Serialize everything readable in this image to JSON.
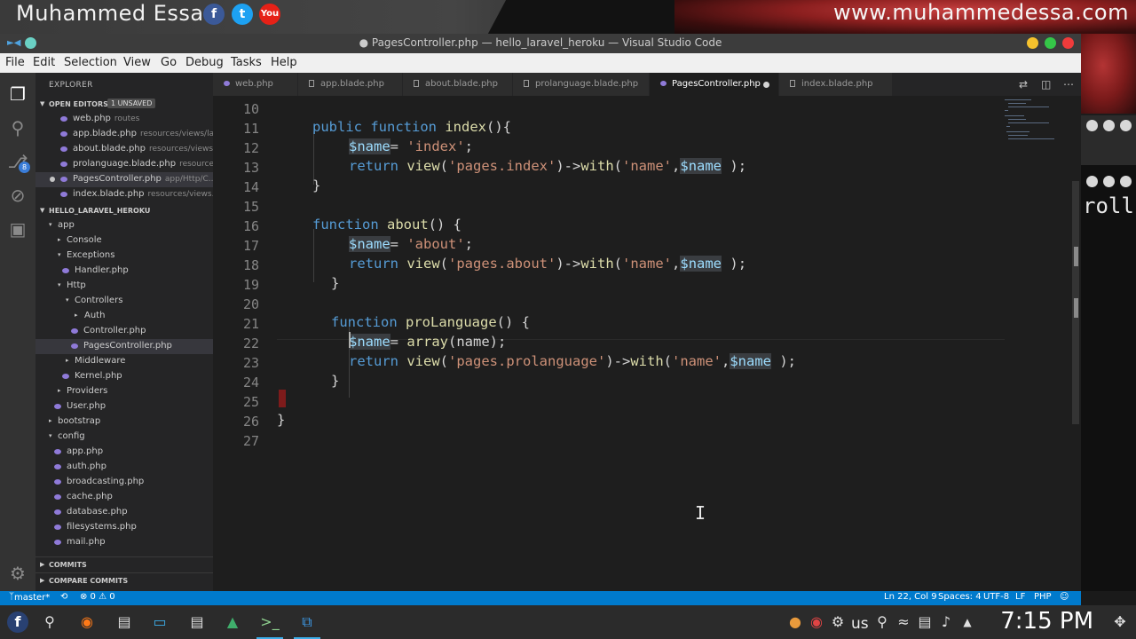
{
  "banner": {
    "name": "Muhammed Essa",
    "url": "www.muhammedessa.com",
    "social": {
      "facebook": "f",
      "twitter": "t",
      "youtube": "You"
    }
  },
  "side_terminal": {
    "text": "roll"
  },
  "window": {
    "title": "● PagesController.php — hello_laravel_heroku — Visual Studio Code"
  },
  "menu": [
    "File",
    "Edit",
    "Selection",
    "View",
    "Go",
    "Debug",
    "Tasks",
    "Help"
  ],
  "activity": {
    "scm_badge": "8"
  },
  "explorer": {
    "title": "EXPLORER",
    "open_editors_label": "OPEN EDITORS",
    "unsaved_badge": "1 UNSAVED",
    "open_editors": [
      {
        "name": "web.php",
        "path": "routes"
      },
      {
        "name": "app.blade.php",
        "path": "resources/views/la..."
      },
      {
        "name": "about.blade.php",
        "path": "resources/views..."
      },
      {
        "name": "prolanguage.blade.php",
        "path": "resource..."
      },
      {
        "name": "PagesController.php",
        "path": "app/Http/C..."
      },
      {
        "name": "index.blade.php",
        "path": "resources/views..."
      }
    ],
    "project_label": "HELLO_LARAVEL_HEROKU",
    "tree": [
      {
        "name": "app"
      },
      {
        "name": "Console"
      },
      {
        "name": "Exceptions"
      },
      {
        "name": "Handler.php"
      },
      {
        "name": "Http"
      },
      {
        "name": "Controllers"
      },
      {
        "name": "Auth"
      },
      {
        "name": "Controller.php"
      },
      {
        "name": "PagesController.php"
      },
      {
        "name": "Middleware"
      },
      {
        "name": "Kernel.php"
      },
      {
        "name": "Providers"
      },
      {
        "name": "User.php"
      },
      {
        "name": "bootstrap"
      },
      {
        "name": "config"
      },
      {
        "name": "app.php"
      },
      {
        "name": "auth.php"
      },
      {
        "name": "broadcasting.php"
      },
      {
        "name": "cache.php"
      },
      {
        "name": "database.php"
      },
      {
        "name": "filesystems.php"
      },
      {
        "name": "mail.php"
      }
    ],
    "commits_label": "COMMITS",
    "compare_label": "COMPARE COMMITS"
  },
  "tabs": [
    {
      "label": "web.php"
    },
    {
      "label": "app.blade.php"
    },
    {
      "label": "about.blade.php"
    },
    {
      "label": "prolanguage.blade.php"
    },
    {
      "label": "PagesController.php"
    },
    {
      "label": "index.blade.php"
    }
  ],
  "code": {
    "line_numbers": [
      "10",
      "11",
      "12",
      "13",
      "14",
      "15",
      "16",
      "17",
      "18",
      "19",
      "20",
      "21",
      "22",
      "23",
      "24",
      "25",
      "26",
      "27"
    ],
    "l11": {
      "kw1": "public",
      "kw2": "function",
      "fn": "index",
      "rest": "(){"
    },
    "l12": {
      "var": "$name",
      "op": "= ",
      "str": "'index'",
      "end": ";"
    },
    "l13": {
      "kw": "return",
      "fn": "view",
      "p1": "(",
      "str1": "'pages.index'",
      "p2": ")->",
      "fn2": "with",
      "p3": "(",
      "str2": "'name'",
      "p4": ",",
      "var": "$name",
      "end": " );"
    },
    "l14": "}",
    "l16": {
      "kw": "function",
      "fn": "about",
      "rest": "() {"
    },
    "l17": {
      "var": "$name",
      "op": "= ",
      "str": "'about'",
      "end": ";"
    },
    "l18": {
      "kw": "return",
      "fn": "view",
      "p1": "(",
      "str1": "'pages.about'",
      "p2": ")->",
      "fn2": "with",
      "p3": "(",
      "str2": "'name'",
      "p4": ",",
      "var": "$name",
      "end": " );"
    },
    "l19": "}",
    "l21": {
      "kw": "function",
      "fn": "proLanguage",
      "rest": "() {"
    },
    "l22": {
      "var": "$name",
      "op": "= ",
      "fn": "array",
      "rest": "(name);"
    },
    "l23": {
      "kw": "return",
      "fn": "view",
      "p1": "(",
      "str1": "'pages.prolanguage'",
      "p2": ")->",
      "fn2": "with",
      "p3": "(",
      "str2": "'name'",
      "p4": ",",
      "var": "$name",
      "end": " );"
    },
    "l24": "}",
    "l26": "}"
  },
  "status": {
    "branch": "master*",
    "sync": "⟲",
    "problems": "⊗ 0 ⚠ 0",
    "position": "Ln 22, Col 9",
    "spaces": "Spaces: 4",
    "encoding": "UTF-8",
    "eol": "LF",
    "language": "PHP",
    "feedback": "☺"
  },
  "taskbar": {
    "keyboard": "us",
    "clock": "7:15 PM"
  }
}
